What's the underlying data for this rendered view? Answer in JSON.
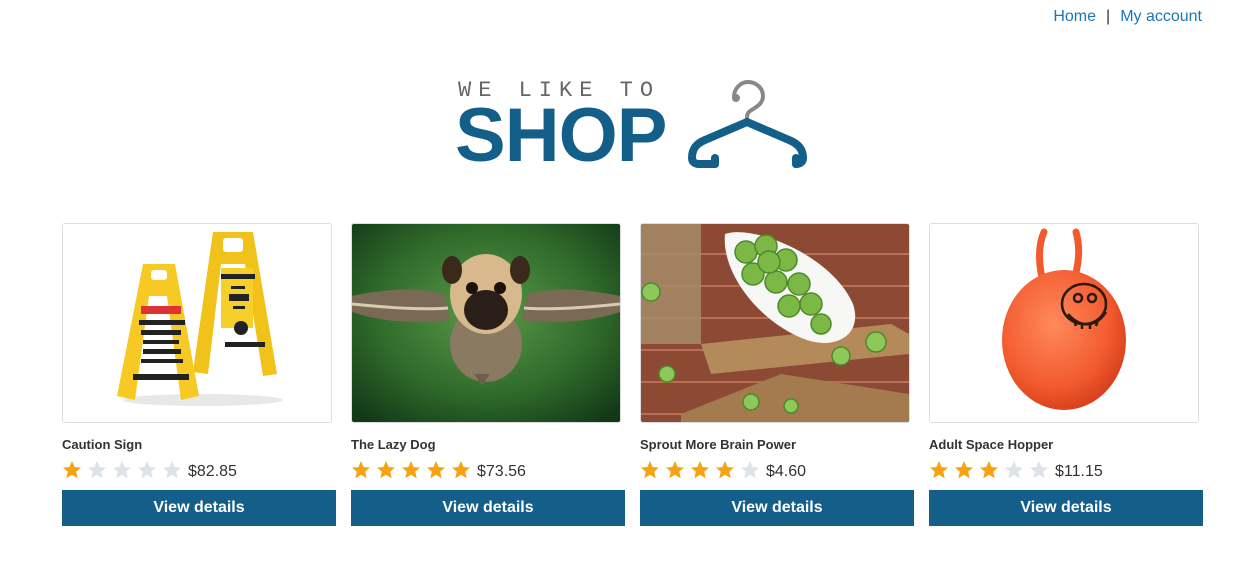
{
  "nav": {
    "home": "Home",
    "separator": "|",
    "account": "My account"
  },
  "logo": {
    "tagline": "WE LIKE TO",
    "word": "SHOP",
    "icon": "hanger-icon"
  },
  "colors": {
    "brand": "#135f8a",
    "link": "#1a75bb",
    "star_filled": "#f5a312",
    "star_empty": "#dde3e8"
  },
  "products": [
    {
      "name": "Caution Sign",
      "rating": 1,
      "max_rating": 5,
      "price": "$82.85",
      "button": "View details"
    },
    {
      "name": "The Lazy Dog",
      "rating": 5,
      "max_rating": 5,
      "price": "$73.56",
      "button": "View details"
    },
    {
      "name": "Sprout More Brain Power",
      "rating": 4,
      "max_rating": 5,
      "price": "$4.60",
      "button": "View details"
    },
    {
      "name": "Adult Space Hopper",
      "rating": 3,
      "max_rating": 5,
      "price": "$11.15",
      "button": "View details"
    }
  ]
}
